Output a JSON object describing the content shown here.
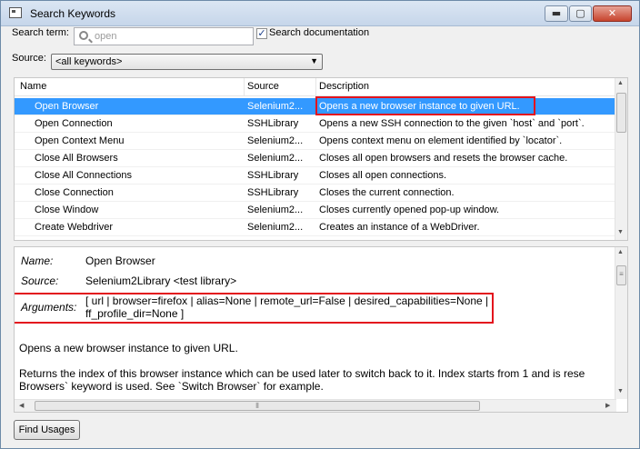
{
  "window": {
    "title": "Search Keywords",
    "controls": {
      "minimize": "▬",
      "maximize": "▢",
      "close": "✕"
    }
  },
  "search": {
    "label": "Search term:",
    "placeholder": "open",
    "documentation_checkbox": {
      "label": "Search documentation",
      "checked": true,
      "mark": "✓"
    }
  },
  "source": {
    "label": "Source:",
    "selected": "<all keywords>",
    "arrow": "▼"
  },
  "keyword_table": {
    "columns": [
      "Name",
      "Source",
      "Description"
    ],
    "rows": [
      {
        "name": "Open Browser",
        "source": "Selenium2...",
        "description": "Opens a new browser instance to given URL.",
        "selected": true
      },
      {
        "name": "Open Connection",
        "source": "SSHLibrary",
        "description": "Opens a new SSH connection to the given `host` and `port`."
      },
      {
        "name": "Open Context Menu",
        "source": "Selenium2...",
        "description": "Opens context menu on element identified by `locator`."
      },
      {
        "name": "Close All Browsers",
        "source": "Selenium2...",
        "description": "Closes all open browsers and resets the browser cache."
      },
      {
        "name": "Close All Connections",
        "source": "SSHLibrary",
        "description": "Closes all open connections."
      },
      {
        "name": "Close Connection",
        "source": "SSHLibrary",
        "description": "Closes the current connection."
      },
      {
        "name": "Close Window",
        "source": "Selenium2...",
        "description": "Closes currently opened pop-up window."
      },
      {
        "name": "Create Webdriver",
        "source": "Selenium2...",
        "description": "Creates an instance of a WebDriver."
      }
    ],
    "scroll_up": "▲",
    "scroll_down": "▼"
  },
  "details": {
    "name_label": "Name:",
    "name_value": "Open Browser",
    "source_label": "Source:",
    "source_value": "Selenium2Library <test library>",
    "arguments_label": "Arguments:",
    "arguments_line1": "[ url | browser=firefox | alias=None | remote_url=False | desired_capabilities=None |",
    "arguments_line2": "ff_profile_dir=None ]",
    "doc_line1": "Opens a new browser instance to given URL.",
    "doc_line2": "Returns the index of this browser instance which can be used later to switch back to it. Index starts from 1 and is rese",
    "doc_line3": "Browsers` keyword is used. See `Switch Browser` for example.",
    "scroll_up": "▲",
    "scroll_down": "▼",
    "scroll_left": "◀",
    "scroll_right": "▶",
    "grip": "≡",
    "hgrip": "⦀"
  },
  "footer": {
    "find_usages_label": "Find Usages"
  }
}
